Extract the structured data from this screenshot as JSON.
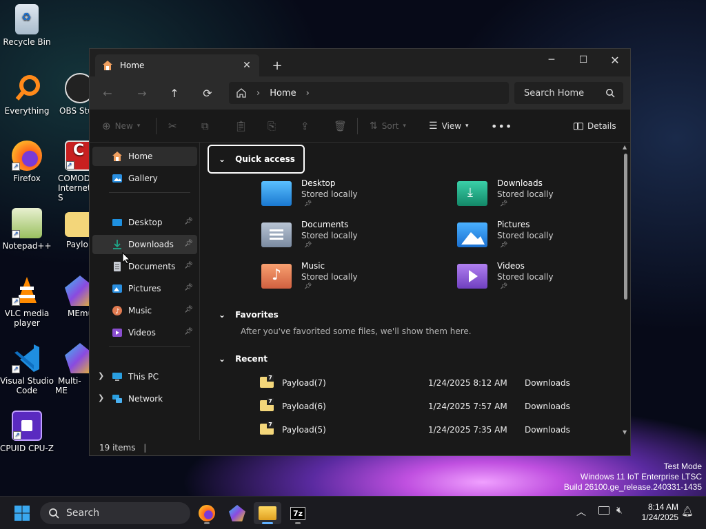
{
  "desktop": {
    "icons": [
      {
        "label": "Recycle Bin"
      },
      {
        "label": "Everything"
      },
      {
        "label": "OBS Stu"
      },
      {
        "label": "Firefox"
      },
      {
        "label": "COMOD Internet S"
      },
      {
        "label": "Notepad++"
      },
      {
        "label": "Paylo"
      },
      {
        "label": "VLC media player"
      },
      {
        "label": "MEmu"
      },
      {
        "label": "Visual Studio Code"
      },
      {
        "label": "Multi-ME"
      },
      {
        "label": "CPUID CPU-Z"
      }
    ],
    "system_info": {
      "line1": "Test Mode",
      "line2": "Windows 11 IoT Enterprise LTSC",
      "line3": "Build 26100.ge_release.240331-1435"
    }
  },
  "window": {
    "tab_title": "Home",
    "breadcrumb": "Home",
    "search_placeholder": "Search Home",
    "toolbar": {
      "new": "New",
      "sort": "Sort",
      "view": "View",
      "details": "Details"
    },
    "sidebar": {
      "top": [
        {
          "label": "Home"
        },
        {
          "label": "Gallery"
        }
      ],
      "pinned": [
        {
          "label": "Desktop"
        },
        {
          "label": "Downloads"
        },
        {
          "label": "Documents"
        },
        {
          "label": "Pictures"
        },
        {
          "label": "Music"
        },
        {
          "label": "Videos"
        }
      ],
      "bottom": [
        {
          "label": "This PC"
        },
        {
          "label": "Network"
        }
      ]
    },
    "quick_access": {
      "heading": "Quick access",
      "items": [
        {
          "name": "Desktop",
          "status": "Stored locally",
          "color": "#1e90e0"
        },
        {
          "name": "Downloads",
          "status": "Stored locally",
          "color": "#1fa88a"
        },
        {
          "name": "Documents",
          "status": "Stored locally",
          "color": "#8a9ab0"
        },
        {
          "name": "Pictures",
          "status": "Stored locally",
          "color": "#2a8fe0"
        },
        {
          "name": "Music",
          "status": "Stored locally",
          "color": "#e07a50"
        },
        {
          "name": "Videos",
          "status": "Stored locally",
          "color": "#8a4ed0"
        }
      ]
    },
    "favorites": {
      "heading": "Favorites",
      "empty_text": "After you've favorited some files, we'll show them here."
    },
    "recent": {
      "heading": "Recent",
      "rows": [
        {
          "name": "Payload(7)",
          "date": "1/24/2025 8:12 AM",
          "location": "Downloads"
        },
        {
          "name": "Payload(6)",
          "date": "1/24/2025 7:57 AM",
          "location": "Downloads"
        },
        {
          "name": "Payload(5)",
          "date": "1/24/2025 7:35 AM",
          "location": "Downloads"
        }
      ]
    },
    "status": "19 items"
  },
  "taskbar": {
    "search_label": "Search",
    "time": "8:14 AM",
    "date": "1/24/2025",
    "sevenzip_label": "7z"
  }
}
